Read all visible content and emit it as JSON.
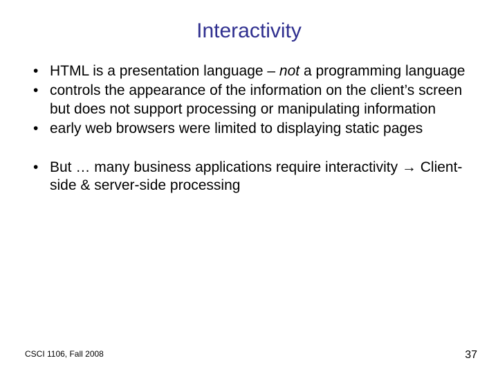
{
  "title": "Interactivity",
  "group1": {
    "b1a": "HTML is a presentation language – ",
    "b1b": "not",
    "b1c": " a programming language",
    "b2": "controls the appearance of the information on the client’s screen but does not support processing or manipulating information",
    "b3": "early web browsers were limited to displaying static pages"
  },
  "group2": {
    "b1": "But … many business applications require interactivity → Client-side & server-side processing"
  },
  "footer": {
    "course": "CSCI 1106, Fall 2008",
    "page": "37"
  }
}
